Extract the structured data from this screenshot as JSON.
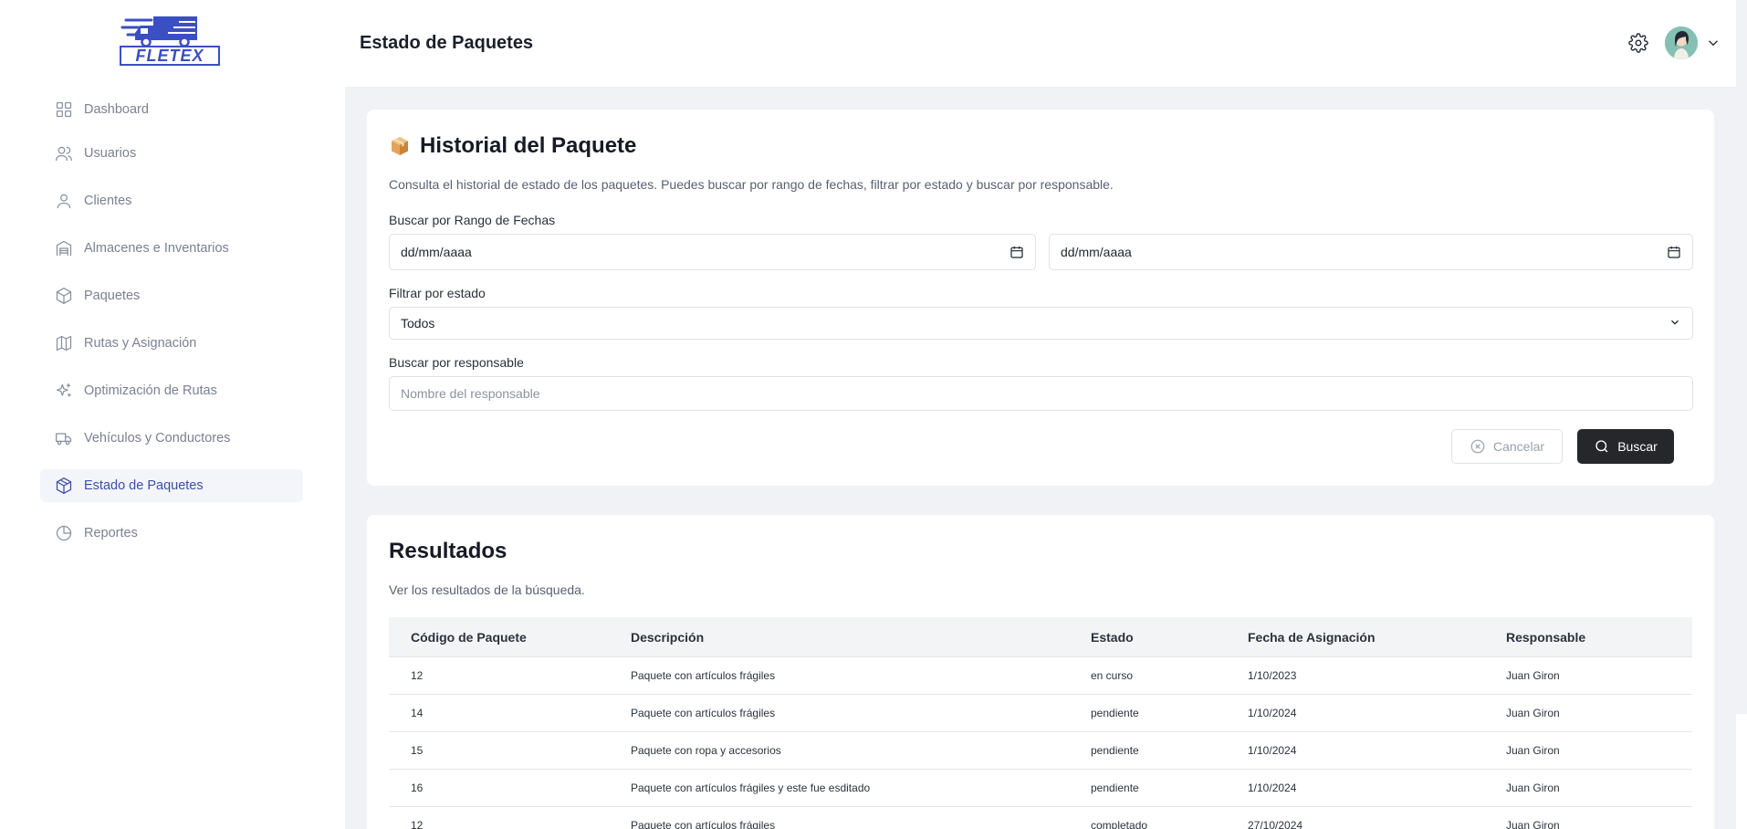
{
  "app": {
    "logo_text": "FLETEX"
  },
  "sidebar": {
    "items": [
      {
        "label": "Dashboard",
        "icon": "dashboard-icon",
        "active": false
      },
      {
        "label": "Usuarios",
        "icon": "users-icon",
        "active": false
      },
      {
        "label": "Clientes",
        "icon": "user-icon",
        "active": false
      },
      {
        "label": "Almacenes e Inventarios",
        "icon": "warehouse-icon",
        "active": false
      },
      {
        "label": "Paquetes",
        "icon": "package-icon",
        "active": false
      },
      {
        "label": "Rutas y Asignación",
        "icon": "map-icon",
        "active": false
      },
      {
        "label": "Optimización de Rutas",
        "icon": "sparkles-icon",
        "active": false
      },
      {
        "label": "Vehículos y Conductores",
        "icon": "truck-icon",
        "active": false
      },
      {
        "label": "Estado de Paquetes",
        "icon": "package-status-icon",
        "active": true
      },
      {
        "label": "Reportes",
        "icon": "pie-chart-icon",
        "active": false
      }
    ]
  },
  "header": {
    "title": "Estado de Paquetes"
  },
  "history": {
    "title": "Historial del Paquete",
    "description": "Consulta el historial de estado de los paquetes. Puedes buscar por rango de fechas, filtrar por estado y buscar por responsable.",
    "date_range_label": "Buscar por Rango de Fechas",
    "date_from_value": "dd/mm/aaaa",
    "date_to_value": "dd/mm/aaaa",
    "status_label": "Filtrar por estado",
    "status_selected": "Todos",
    "responsible_label": "Buscar por responsable",
    "responsible_placeholder": "Nombre del responsable",
    "cancel_label": "Cancelar",
    "search_label": "Buscar"
  },
  "results": {
    "title": "Resultados",
    "description": "Ver los resultados de la búsqueda.",
    "columns": [
      "Código de Paquete",
      "Descripción",
      "Estado",
      "Fecha de Asignación",
      "Responsable"
    ],
    "rows": [
      [
        "12",
        "Paquete con artículos frágiles",
        "en curso",
        "1/10/2023",
        "Juan Giron"
      ],
      [
        "14",
        "Paquete con artículos frágiles",
        "pendiente",
        "1/10/2024",
        "Juan Giron"
      ],
      [
        "15",
        "Paquete con ropa y accesorios",
        "pendiente",
        "1/10/2024",
        "Juan Giron"
      ],
      [
        "16",
        "Paquete con artículos frágiles y este fue esditado",
        "pendiente",
        "1/10/2024",
        "Juan Giron"
      ],
      [
        "12",
        "Paquete con artículos frágiles",
        "completado",
        "27/10/2024",
        "Juan Giron"
      ]
    ]
  },
  "colors": {
    "accent": "#3c4ea8",
    "dark_button": "#26272b",
    "page_bg": "#f1f2f6"
  }
}
